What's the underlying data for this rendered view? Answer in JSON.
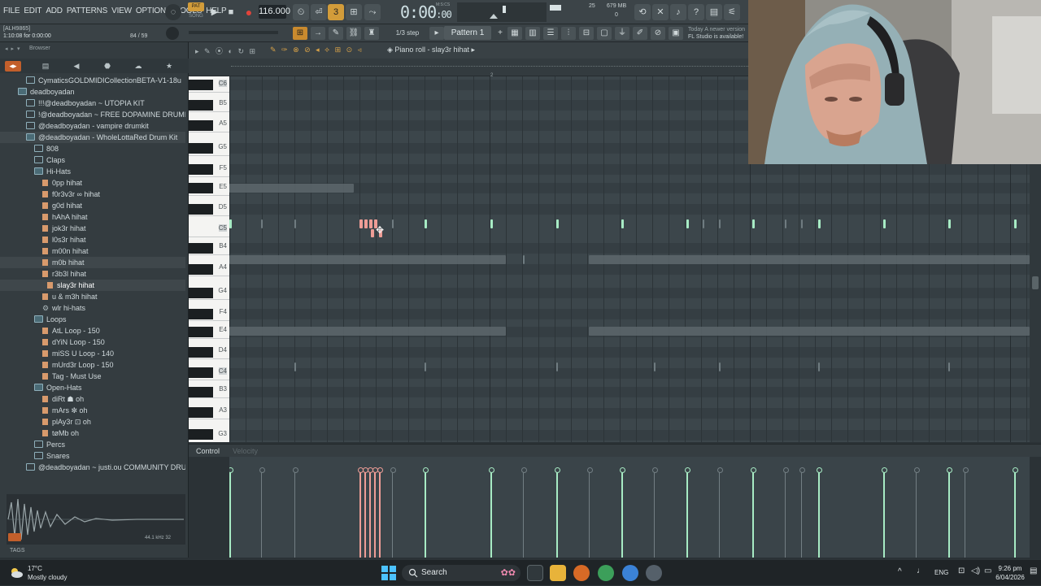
{
  "menu": [
    "FILE",
    "EDIT",
    "ADD",
    "PATTERNS",
    "VIEW",
    "OPTIONS",
    "TOOLS",
    "HELP"
  ],
  "transport": {
    "pat_label": "PAT",
    "song_label": "SONG",
    "tempo": "116.000",
    "time": "0:00",
    "time_small": ":00",
    "time_unit": "M:S:CS",
    "cpu_value": "25",
    "cpu_value2": "0",
    "memory": "679 MB"
  },
  "hint": {
    "line1": "[ALH9865]",
    "line2": "1:10:08 for 0:00:00",
    "counter": "84 / 59"
  },
  "step": "1/3 step",
  "pattern": "Pattern 1",
  "news": {
    "line1": "Today  A newer version",
    "line2": "FL Studio is available!"
  },
  "browser": {
    "title": "Browser",
    "tree": [
      {
        "label": "CymaticsGOLDMIDICollectionBETA-V1-18u",
        "indent": 32,
        "type": "folder"
      },
      {
        "label": "deadboyadan",
        "indent": 22,
        "type": "folder open"
      },
      {
        "label": "!!!@deadboyadan ~ UTOPIA KIT",
        "indent": 32,
        "type": "folder"
      },
      {
        "label": "!@deadboyadan ~ FREE DOPAMINE DRUMKIT",
        "indent": 32,
        "type": "folder"
      },
      {
        "label": "@deadboyadan - vampire drumkit",
        "indent": 32,
        "type": "folder"
      },
      {
        "label": "@deadboyadan - WholeLottaRed Drum Kit",
        "indent": 32,
        "type": "folder open sel"
      },
      {
        "label": "808",
        "indent": 42,
        "type": "folder"
      },
      {
        "label": "Claps",
        "indent": 42,
        "type": "folder"
      },
      {
        "label": "Hi-Hats",
        "indent": 42,
        "type": "folder open"
      },
      {
        "label": "0pp hihat",
        "indent": 52,
        "type": "file"
      },
      {
        "label": "f0r3v3r ∞ hihat",
        "indent": 52,
        "type": "file"
      },
      {
        "label": "g0d hihat",
        "indent": 52,
        "type": "file"
      },
      {
        "label": "hAhA hihat",
        "indent": 52,
        "type": "file"
      },
      {
        "label": "jok3r hihat",
        "indent": 52,
        "type": "file"
      },
      {
        "label": "l0s3r hihat",
        "indent": 52,
        "type": "file"
      },
      {
        "label": "m00n hihat",
        "indent": 52,
        "type": "file"
      },
      {
        "label": "m0b hihat",
        "indent": 52,
        "type": "file sel"
      },
      {
        "label": "r3b3l hihat",
        "indent": 52,
        "type": "file"
      },
      {
        "label": "slay3r hihat",
        "indent": 58,
        "type": "file sel hl"
      },
      {
        "label": "u & m3h hihat",
        "indent": 52,
        "type": "file"
      },
      {
        "label": "wlr hi-hats",
        "indent": 52,
        "type": "gear"
      },
      {
        "label": "Loops",
        "indent": 42,
        "type": "folder open"
      },
      {
        "label": "AtL Loop - 150",
        "indent": 52,
        "type": "file"
      },
      {
        "label": "dYiN Loop - 150",
        "indent": 52,
        "type": "file"
      },
      {
        "label": "miSS U Loop - 140",
        "indent": 52,
        "type": "file"
      },
      {
        "label": "mUrd3r Loop - 150",
        "indent": 52,
        "type": "file"
      },
      {
        "label": "Tag - Must Use",
        "indent": 52,
        "type": "file"
      },
      {
        "label": "Open-Hats",
        "indent": 42,
        "type": "folder open"
      },
      {
        "label": "diRt ☗ oh",
        "indent": 52,
        "type": "file"
      },
      {
        "label": "mArs ✼ oh",
        "indent": 52,
        "type": "file"
      },
      {
        "label": "plAy3r ⊡ oh",
        "indent": 52,
        "type": "file"
      },
      {
        "label": "tøMb oh",
        "indent": 52,
        "type": "file"
      },
      {
        "label": "Percs",
        "indent": 42,
        "type": "folder"
      },
      {
        "label": "Snares",
        "indent": 42,
        "type": "folder"
      },
      {
        "label": "@deadboyadan ~ justi.ou COMMUNITY DRUMKIT",
        "indent": 32,
        "type": "folder"
      }
    ],
    "wave_info": "44.1 kHz 32",
    "tags_label": "TAGS"
  },
  "piano_roll": {
    "title": "Piano roll - slay3r hihat",
    "bar_marker": "2",
    "key_labels": [
      "C6",
      "B5",
      "A5",
      "G5",
      "F5",
      "E5",
      "D5",
      "C5",
      "B4",
      "A4",
      "G4",
      "F4",
      "E4",
      "D4",
      "C4",
      "B3",
      "A3",
      "G3"
    ],
    "control_label": "Control",
    "control_sub": "Velocity"
  },
  "taskbar": {
    "temp": "17°C",
    "weather": "Mostly cloudy",
    "search": "Search",
    "lang": "ENG",
    "time": "9:26 pm",
    "date": "6/04/2026"
  },
  "colors": {
    "note": "#a7ebc4",
    "note_selected": "#ee9d96",
    "accent": "#c25f2b"
  }
}
